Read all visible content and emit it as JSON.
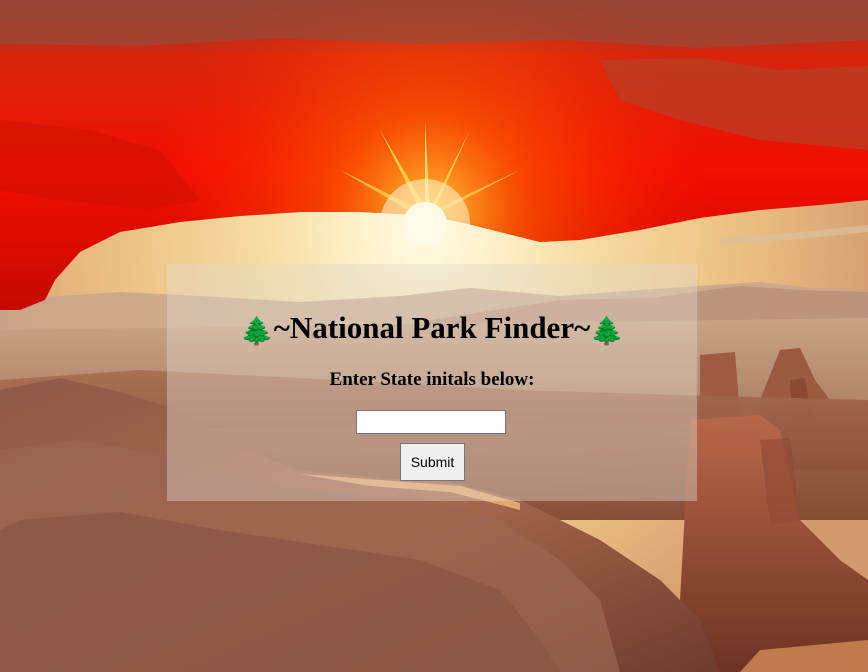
{
  "page": {
    "title_prefix_icon": "evergreen-tree-icon",
    "title_text": "~National Park Finder~",
    "title_suffix_icon": "evergreen-tree-icon",
    "prompt": "Enter State initals below:"
  },
  "form": {
    "state_value": "",
    "state_placeholder": "",
    "submit_label": "Submit"
  },
  "colors": {
    "panel_overlay": "rgba(225,218,205,0.42)",
    "arch_red": "#e10f00",
    "rock_brown": "#9a5a43",
    "sky_glow": "#f8e6b8"
  }
}
